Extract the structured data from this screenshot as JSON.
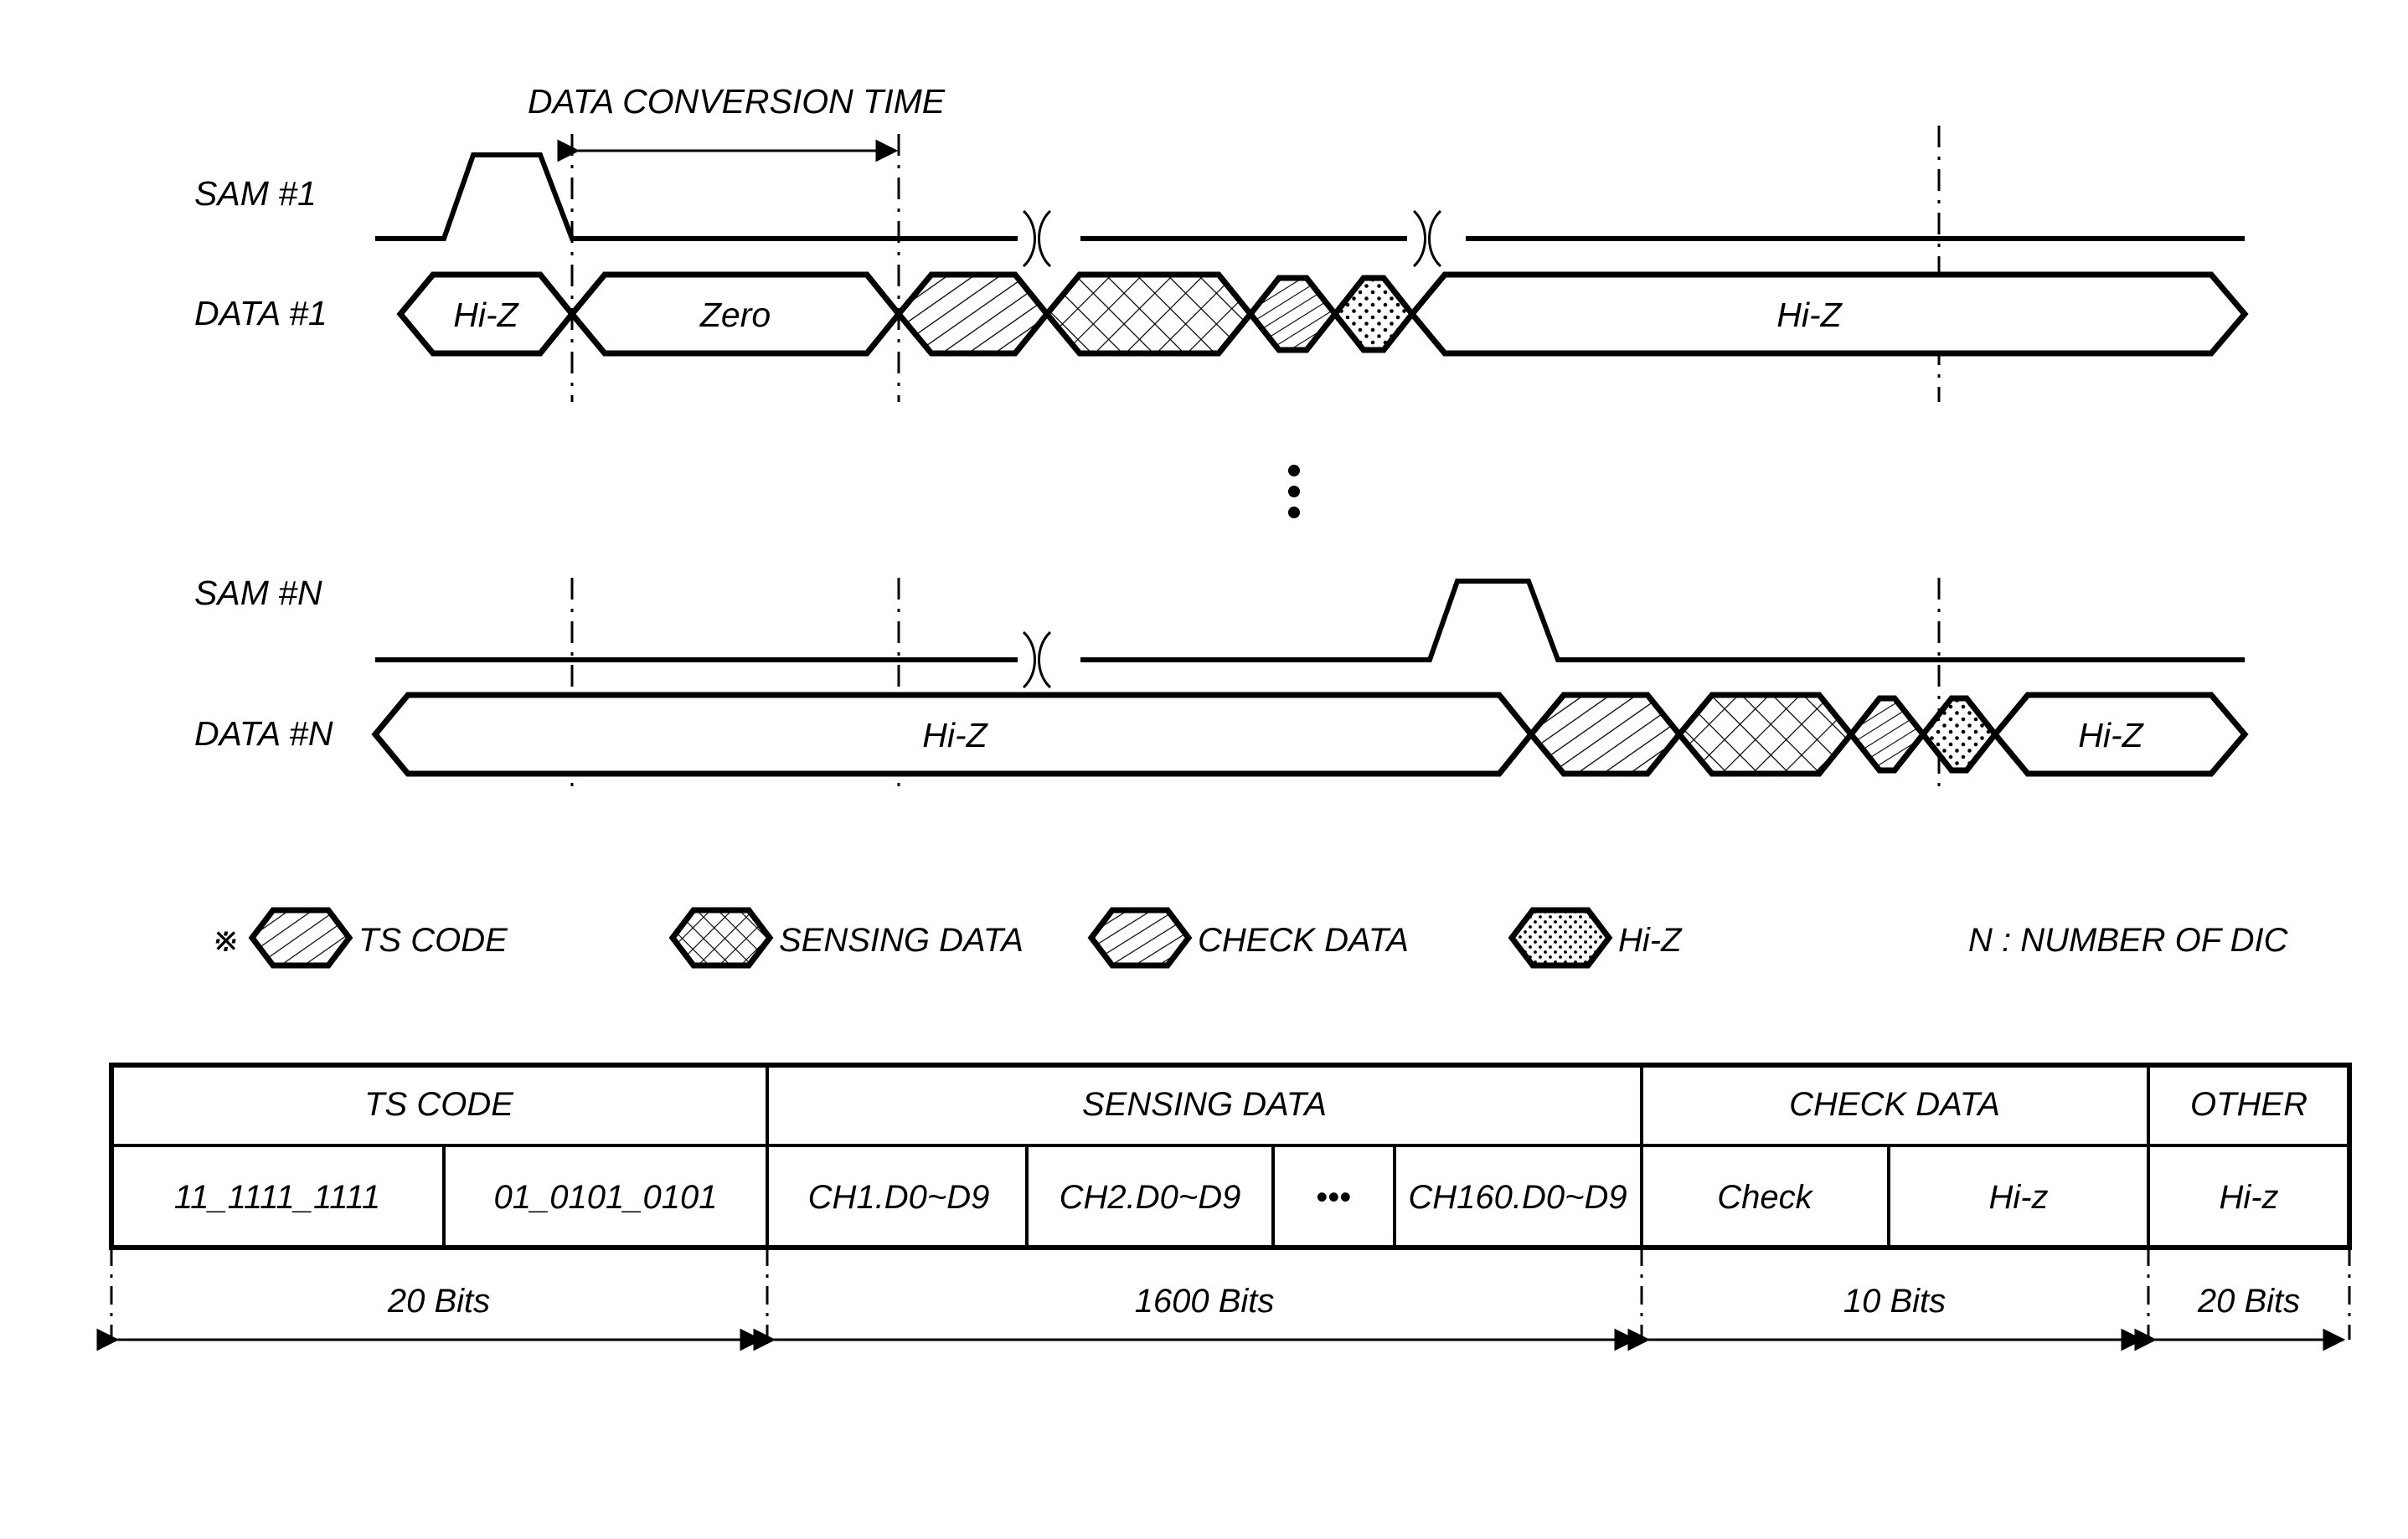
{
  "figure": {
    "title_annotation": "DATA CONVERSION TIME",
    "row_labels": {
      "sam1": "SAM #1",
      "data1": "DATA #1",
      "samN": "SAM #N",
      "dataN": "DATA #N"
    },
    "data1_segments": [
      {
        "label": "Hi-Z",
        "pattern": "none"
      },
      {
        "label": "Zero",
        "pattern": "none"
      },
      {
        "label": "",
        "pattern": "ts-code"
      },
      {
        "label": "",
        "pattern": "sensing-data"
      },
      {
        "label": "",
        "pattern": "check-data"
      },
      {
        "label": "",
        "pattern": "hi-z-dots"
      },
      {
        "label": "Hi-Z",
        "pattern": "none"
      }
    ],
    "dataN_segments": [
      {
        "label": "Hi-Z",
        "pattern": "none"
      },
      {
        "label": "",
        "pattern": "ts-code"
      },
      {
        "label": "",
        "pattern": "sensing-data"
      },
      {
        "label": "",
        "pattern": "check-data"
      },
      {
        "label": "",
        "pattern": "hi-z-dots"
      },
      {
        "label": "Hi-Z",
        "pattern": "none"
      }
    ],
    "ellipsis": "⋮",
    "break_symbol": ")("
  },
  "legend": {
    "marker": "※",
    "items": [
      {
        "label": "TS CODE",
        "pattern": "ts-code"
      },
      {
        "label": "SENSING DATA",
        "pattern": "sensing-data"
      },
      {
        "label": "CHECK DATA",
        "pattern": "check-data"
      },
      {
        "label": "Hi-Z",
        "pattern": "hi-z-dots"
      }
    ],
    "note": "N : NUMBER OF DIC"
  },
  "table": {
    "headers": [
      {
        "label": "TS CODE",
        "span": 2
      },
      {
        "label": "SENSING DATA",
        "span": 4
      },
      {
        "label": "CHECK DATA",
        "span": 2
      },
      {
        "label": "OTHER",
        "span": 1
      }
    ],
    "cells": [
      "11_1111_1111",
      "01_0101_0101",
      "CH1.D0~D9",
      "CH2.D0~D9",
      "•••",
      "CH160.D0~D9",
      "Check",
      "Hi-z",
      "Hi-z"
    ],
    "bits": [
      {
        "label": "20 Bits"
      },
      {
        "label": "1600 Bits"
      },
      {
        "label": "10 Bits"
      },
      {
        "label": "20 Bits"
      }
    ]
  },
  "colors": {
    "ink": "#000000",
    "paper": "#ffffff"
  }
}
